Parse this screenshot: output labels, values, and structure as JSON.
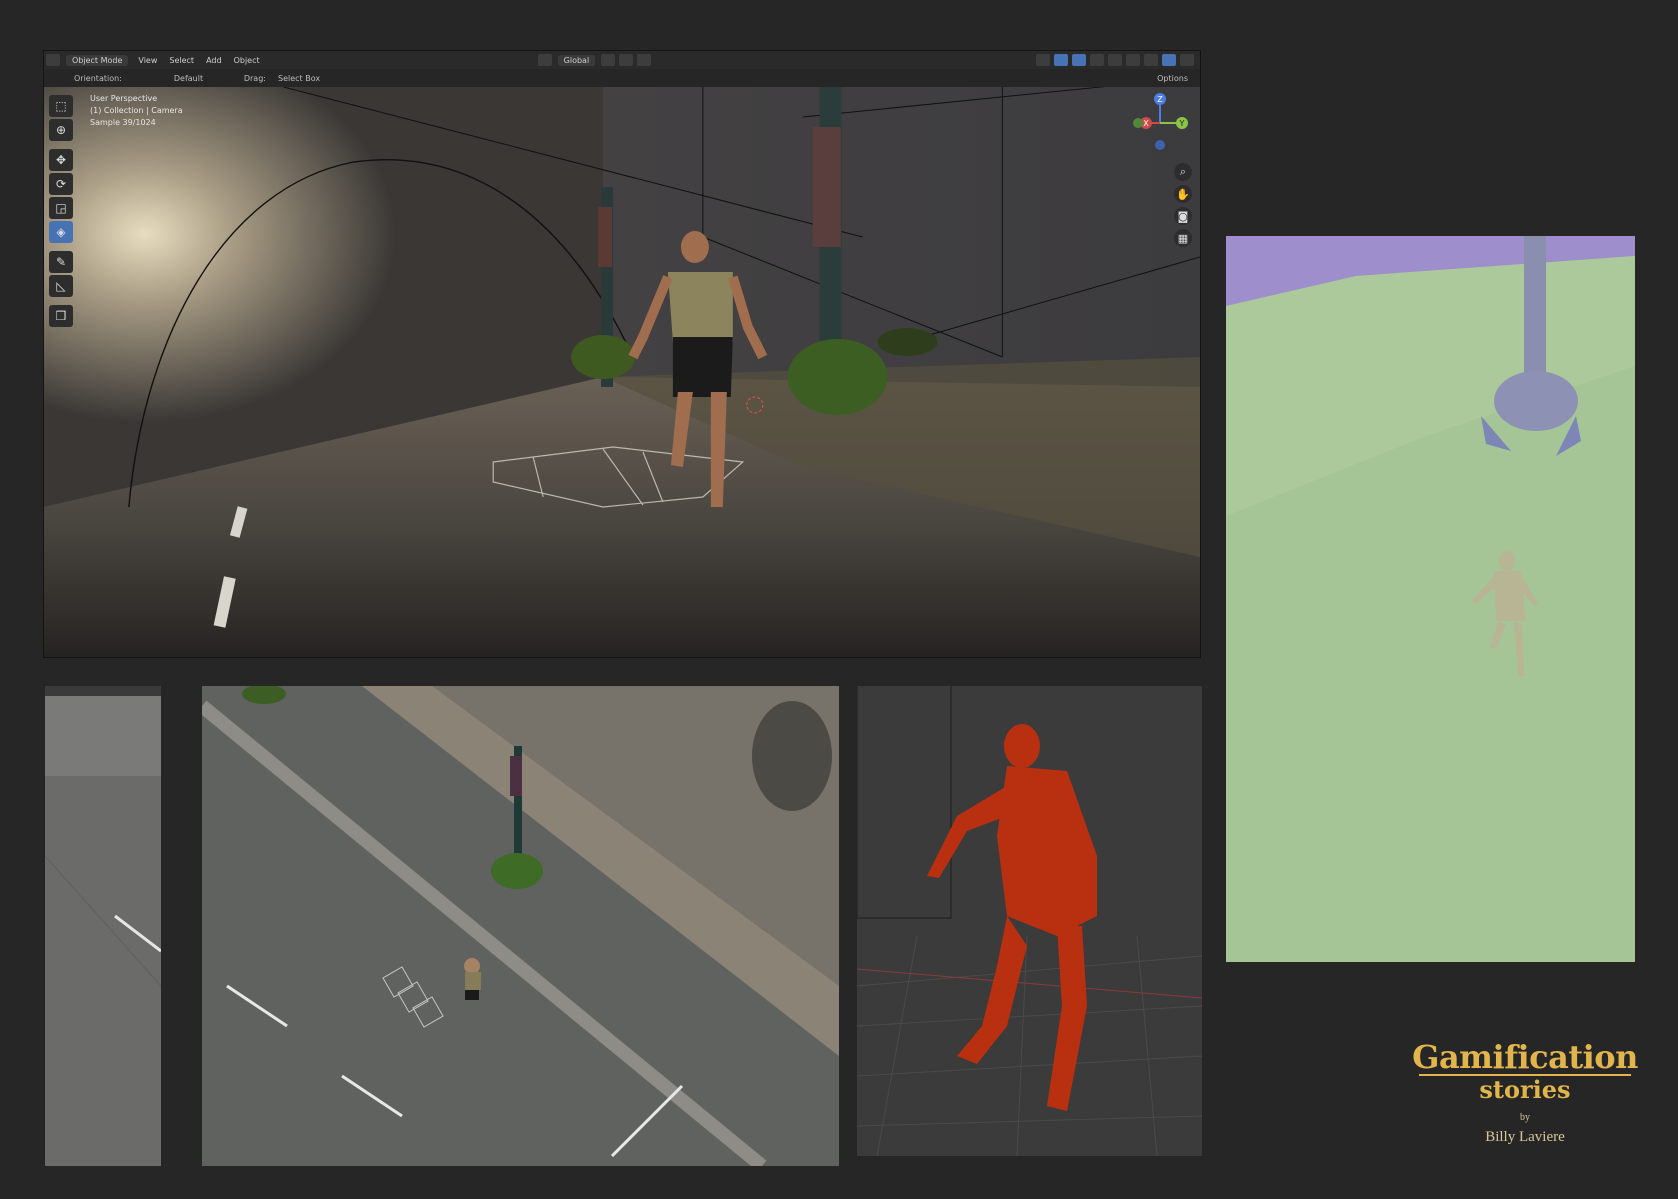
{
  "viewport": {
    "header": {
      "mode": "Object Mode",
      "menus": [
        "View",
        "Select",
        "Add",
        "Object"
      ],
      "transform": "Global",
      "options": "Options"
    },
    "tool_settings": {
      "orientation_label": "Orientation:",
      "orientation_value": "Default",
      "drag_label": "Drag:",
      "drag_value": "Select Box"
    },
    "overlay": {
      "view_name": "User Perspective",
      "collection": "(1) Collection | Camera",
      "sample": "Sample 39/1024"
    },
    "gizmo_axes": [
      "Z",
      "Y",
      "X"
    ],
    "tools": [
      "select-box",
      "cursor",
      "move",
      "rotate",
      "scale",
      "transform",
      "annotate",
      "measure",
      "add-cube"
    ],
    "nav": [
      "zoom-icon",
      "hand-icon",
      "camera-icon",
      "grid-icon"
    ]
  },
  "brand": {
    "title": "Gamification",
    "subtitle": "stories",
    "by": "by",
    "author": "Billy Laviere"
  },
  "colors": {
    "accent": "#e1b44c",
    "blender_blue": "#4772b3",
    "clay_green": "#a5c495",
    "clay_purple": "#9b8cc6",
    "red_model": "#b8300f"
  }
}
